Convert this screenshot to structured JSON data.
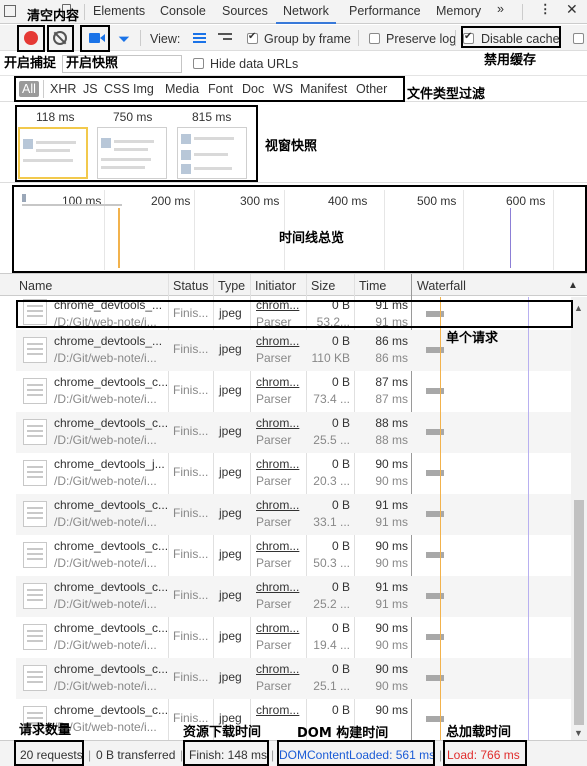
{
  "tabs": [
    "Elements",
    "Console",
    "Sources",
    "Network",
    "Performance",
    "Memory"
  ],
  "active_tab": "Network",
  "toolbar": {
    "view_label": "View:",
    "group_by_frame": "Group by frame",
    "preserve_log": "Preserve log",
    "disable_cache": "Disable cache",
    "hide_data_urls": "Hide data URLs",
    "group_by_frame_checked": true,
    "preserve_log_checked": false,
    "disable_cache_checked": true,
    "hide_data_urls_checked": false
  },
  "filter_types": [
    "All",
    "XHR",
    "JS",
    "CSS",
    "Img",
    "Media",
    "Font",
    "Doc",
    "WS",
    "Manifest",
    "Other"
  ],
  "filmstrip": [
    "118 ms",
    "750 ms",
    "815 ms"
  ],
  "overview_ticks": [
    "100 ms",
    "200 ms",
    "300 ms",
    "400 ms",
    "500 ms",
    "600 ms"
  ],
  "columns": [
    "Name",
    "Status",
    "Type",
    "Initiator",
    "Size",
    "Time",
    "Waterfall"
  ],
  "rows": [
    {
      "name": "chrome_devtools_...",
      "path": "/D:/Git/web-note/i...",
      "status": "Finis...",
      "type": "jpeg",
      "initiator": "chrom...",
      "initiator_sub": "Parser",
      "size": "0 B",
      "size_sub": "53.2...",
      "time": "91 ms",
      "time_sub": "91 ms"
    },
    {
      "name": "chrome_devtools_...",
      "path": "/D:/Git/web-note/i...",
      "status": "Finis...",
      "type": "jpeg",
      "initiator": "chrom...",
      "initiator_sub": "Parser",
      "size": "0 B",
      "size_sub": "110 KB",
      "time": "86 ms",
      "time_sub": "86 ms"
    },
    {
      "name": "chrome_devtools_c...",
      "path": "/D:/Git/web-note/i...",
      "status": "Finis...",
      "type": "jpeg",
      "initiator": "chrom...",
      "initiator_sub": "Parser",
      "size": "0 B",
      "size_sub": "73.4 ...",
      "time": "87 ms",
      "time_sub": "87 ms"
    },
    {
      "name": "chrome_devtools_c...",
      "path": "/D:/Git/web-note/i...",
      "status": "Finis...",
      "type": "jpeg",
      "initiator": "chrom...",
      "initiator_sub": "Parser",
      "size": "0 B",
      "size_sub": "25.5 ...",
      "time": "88 ms",
      "time_sub": "88 ms"
    },
    {
      "name": "chrome_devtools_j...",
      "path": "/D:/Git/web-note/i...",
      "status": "Finis...",
      "type": "jpeg",
      "initiator": "chrom...",
      "initiator_sub": "Parser",
      "size": "0 B",
      "size_sub": "20.3 ...",
      "time": "90 ms",
      "time_sub": "90 ms"
    },
    {
      "name": "chrome_devtools_c...",
      "path": "/D:/Git/web-note/i...",
      "status": "Finis...",
      "type": "jpeg",
      "initiator": "chrom...",
      "initiator_sub": "Parser",
      "size": "0 B",
      "size_sub": "33.1 ...",
      "time": "91 ms",
      "time_sub": "91 ms"
    },
    {
      "name": "chrome_devtools_c...",
      "path": "/D:/Git/web-note/i...",
      "status": "Finis...",
      "type": "jpeg",
      "initiator": "chrom...",
      "initiator_sub": "Parser",
      "size": "0 B",
      "size_sub": "50.3 ...",
      "time": "90 ms",
      "time_sub": "90 ms"
    },
    {
      "name": "chrome_devtools_c...",
      "path": "/D:/Git/web-note/i...",
      "status": "Finis...",
      "type": "jpeg",
      "initiator": "chrom...",
      "initiator_sub": "Parser",
      "size": "0 B",
      "size_sub": "25.2 ...",
      "time": "91 ms",
      "time_sub": "91 ms"
    },
    {
      "name": "chrome_devtools_c...",
      "path": "/D:/Git/web-note/i...",
      "status": "Finis...",
      "type": "jpeg",
      "initiator": "chrom...",
      "initiator_sub": "Parser",
      "size": "0 B",
      "size_sub": "19.4 ...",
      "time": "90 ms",
      "time_sub": "90 ms"
    },
    {
      "name": "chrome_devtools_c...",
      "path": "/D:/Git/web-note/i...",
      "status": "Finis...",
      "type": "jpeg",
      "initiator": "chrom...",
      "initiator_sub": "Parser",
      "size": "0 B",
      "size_sub": "25.1 ...",
      "time": "90 ms",
      "time_sub": "90 ms"
    },
    {
      "name": "chrome_devtools_c...",
      "path": "/D:/Git/web-note/i...",
      "status": "Finis...",
      "type": "jpeg",
      "initiator": "chrom...",
      "initiator_sub": "Parser",
      "size": "0 B",
      "size_sub": "",
      "time": "90 ms",
      "time_sub": ""
    }
  ],
  "status": {
    "requests": "20 requests",
    "transferred": "0 B transferred",
    "finish": "Finish: 148 ms",
    "dcl": "DOMContentLoaded: 561 ms",
    "load": "Load: 766 ms"
  },
  "annotations": {
    "clear": "清空内容",
    "record": "开启捕捉",
    "screenshot": "开启快照",
    "disable_cache": "禁用缓存",
    "filter": "文件类型过滤",
    "filmstrip": "视窗快照",
    "overview": "时间线总览",
    "single_request": "单个请求",
    "request_count": "请求数量",
    "download_time": "资源下载时间",
    "dom_time": "DOM 构建时间",
    "total_load": "总加载时间"
  },
  "colors": {
    "record_red": "#e53935",
    "dcl_blue": "#1a5bd6",
    "load_red": "#e02d2d",
    "accent": "#3879d9"
  }
}
